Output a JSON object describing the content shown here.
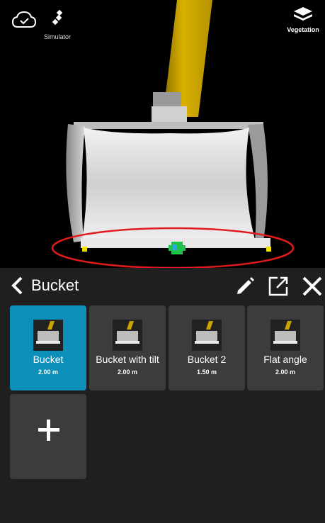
{
  "status": {
    "simulator_label": "Simulator",
    "layer_label": "Vegetation"
  },
  "panel": {
    "title": "Bucket"
  },
  "buckets": [
    {
      "name": "Bucket",
      "width": "2.00 m",
      "selected": true
    },
    {
      "name": "Bucket with tilt",
      "width": "2.00 m",
      "selected": false
    },
    {
      "name": "Bucket 2",
      "width": "1.50 m",
      "selected": false
    },
    {
      "name": "Flat angle",
      "width": "2.00 m",
      "selected": false
    }
  ],
  "colors": {
    "selected_card": "#0e8fba",
    "card": "#3c3c3c",
    "panel_bg": "#1f1f1f",
    "arm": "#c9a400",
    "highlight_ellipse": "#e01b1b",
    "edge_point": "#f0e000",
    "center_point": "#22c95a"
  },
  "icons": {
    "cloud": "cloud-check-icon",
    "satellite": "satellite-icon",
    "layers": "layers-icon",
    "back": "chevron-left-icon",
    "edit": "pencil-icon",
    "external": "open-external-icon",
    "close": "close-icon",
    "add": "plus-icon"
  }
}
